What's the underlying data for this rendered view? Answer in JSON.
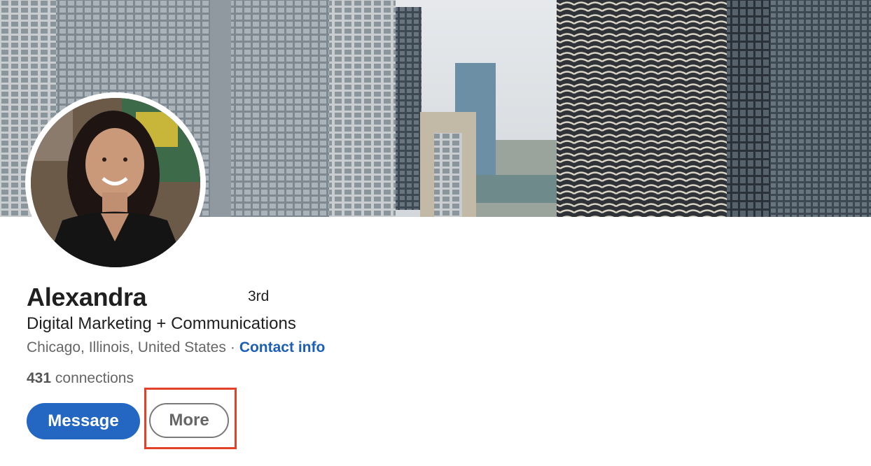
{
  "profile": {
    "name": "Alexandra",
    "degree": "3rd",
    "headline": "Digital Marketing + Communications",
    "location": "Chicago, Illinois, United States",
    "separator": "·",
    "contact_info_label": "Contact info",
    "connections_count": "431",
    "connections_label": "connections"
  },
  "actions": {
    "message_label": "Message",
    "more_label": "More"
  },
  "colors": {
    "primary_button": "#2467c2",
    "link": "#1d5fb8",
    "highlight": "#e2412a"
  }
}
